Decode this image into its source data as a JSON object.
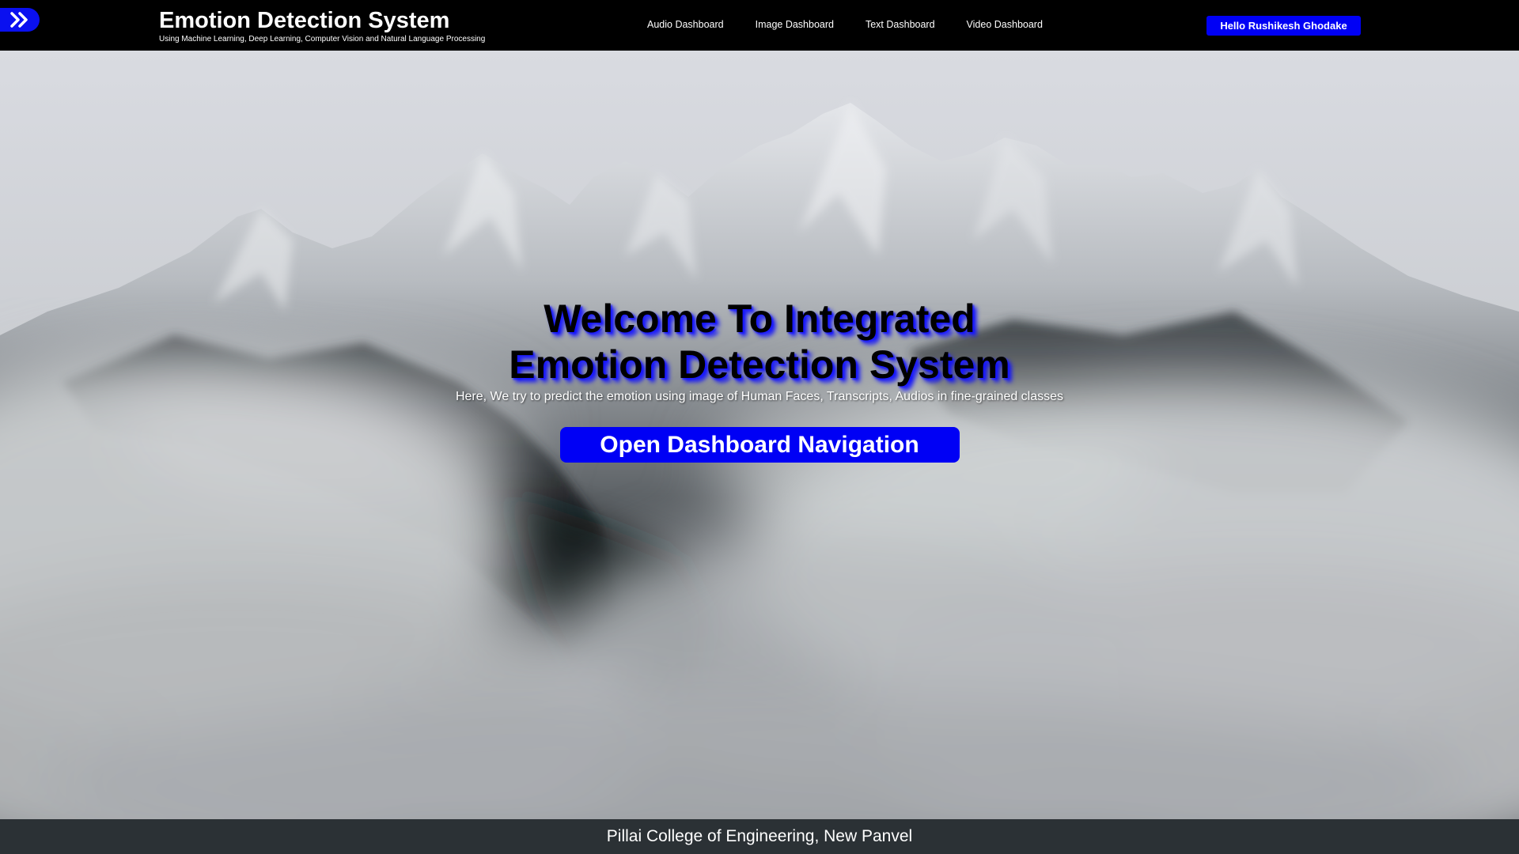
{
  "header": {
    "title": "Emotion Detection System",
    "subtitle": "Using Machine Learning, Deep Learning, Computer Vision and Natural Language Processing",
    "menu_icon": "double-chevron-right-icon",
    "nav": [
      {
        "label": "Audio Dashboard"
      },
      {
        "label": "Image Dashboard"
      },
      {
        "label": "Text Dashboard"
      },
      {
        "label": "Video Dashboard"
      }
    ],
    "user_button": "Hello Rushikesh Ghodake"
  },
  "hero": {
    "title_line1": "Welcome To Integrated",
    "title_line2": "Emotion Detection System",
    "subtitle": "Here, We try to predict the emotion using image of Human Faces, Transcripts, Audios in fine-grained classes",
    "cta": "Open Dashboard Navigation"
  },
  "footer": {
    "text": "Pillai College of Engineering, New Panvel"
  },
  "colors": {
    "accent": "#0000f5",
    "header_bg": "#000000",
    "footer_bg": "#2b3135"
  }
}
